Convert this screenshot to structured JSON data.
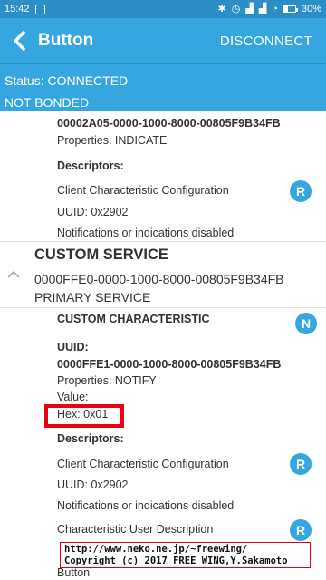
{
  "statusbar": {
    "time": "15:42",
    "battery": "30%",
    "battery_fraction": 0.3
  },
  "appbar": {
    "title": "Button",
    "disconnect_label": "DISCONNECT"
  },
  "connection": {
    "status": "Status: CONNECTED",
    "bond": "NOT BONDED"
  },
  "char_prev": {
    "uuid": "00002A05-0000-1000-8000-00805F9B34FB",
    "properties": "Properties: INDICATE",
    "descriptors_label": "Descriptors:",
    "descriptor": {
      "name": "Client Characteristic Configuration",
      "uuid": "UUID: 0x2902",
      "value": "Notifications or indications disabled",
      "badge": "R"
    }
  },
  "service": {
    "title": "CUSTOM SERVICE",
    "uuid": "0000FFE0-0000-1000-8000-00805F9B34FB",
    "type": "PRIMARY SERVICE"
  },
  "characteristic": {
    "title": "CUSTOM CHARACTERISTIC",
    "badge": "N",
    "uuid_label": "UUID:",
    "uuid": "0000FFE1-0000-1000-8000-00805F9B34FB",
    "properties": "Properties: NOTIFY",
    "value_label": "Value:",
    "hex": "Hex: 0x01",
    "descriptors_label": "Descriptors:",
    "descriptors": [
      {
        "name": "Client Characteristic Configuration",
        "uuid": "UUID: 0x2902",
        "value": "Notifications or indications disabled",
        "badge": "R"
      },
      {
        "name": "Characteristic User Description",
        "badge": "R",
        "value": "Button"
      }
    ]
  },
  "watermark": {
    "line1": "http://www.neko.ne.jp/~freewing/",
    "line2": "Copyright (c) 2017 FREE WING,Y.Sakamoto"
  },
  "colors": {
    "appbar": "#35a6e0",
    "statusbar": "#2b8fc6",
    "highlight": "#e60012"
  }
}
